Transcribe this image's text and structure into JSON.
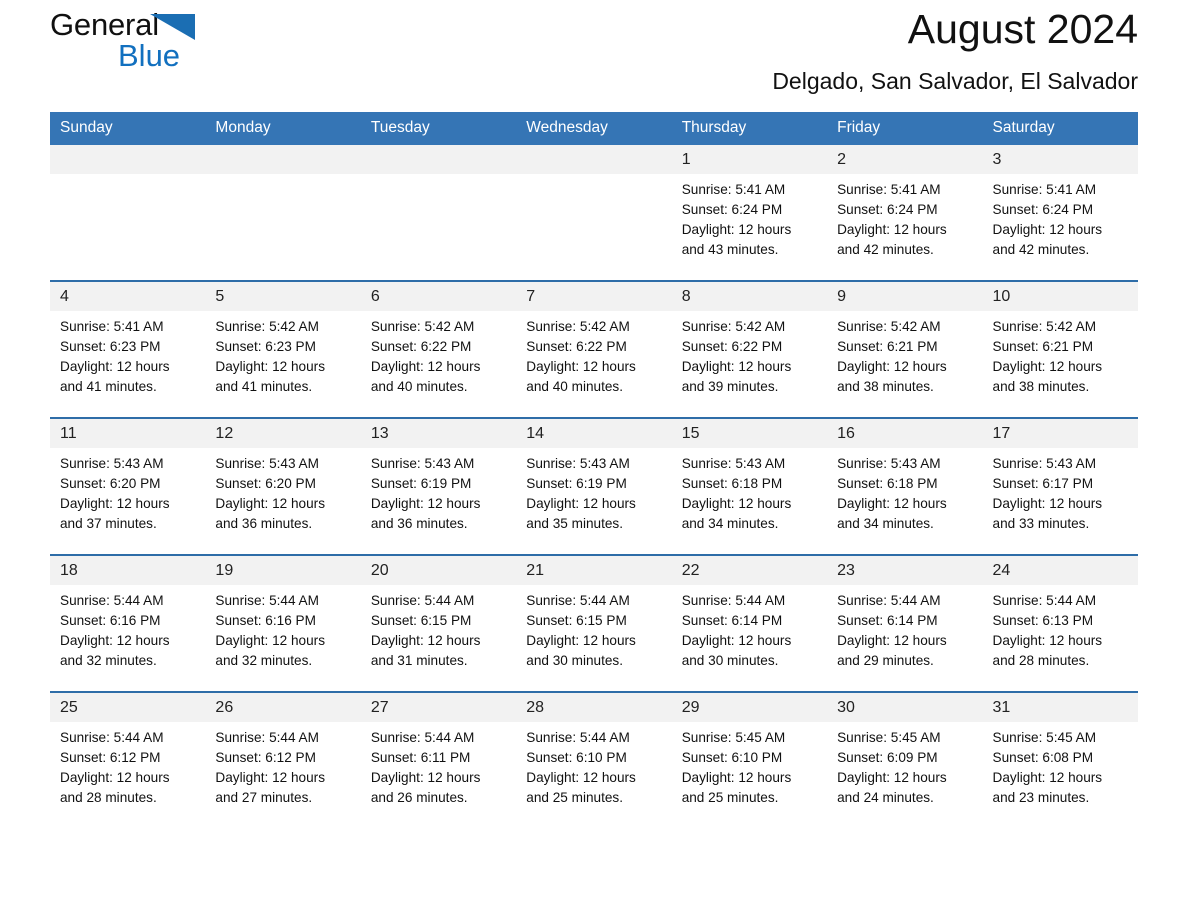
{
  "brand": {
    "name_part1": "General",
    "name_part2": "Blue",
    "logo_icon": "triangle-logo-icon",
    "accent_color": "#1B6EB3"
  },
  "header": {
    "title": "August 2024",
    "location": "Delgado, San Salvador, El Salvador"
  },
  "theme": {
    "header_blue": "#3575B5",
    "row_rule": "#2E6DA8",
    "daynum_band": "#F2F2F2"
  },
  "calendar": {
    "weekday_headers": [
      "Sunday",
      "Monday",
      "Tuesday",
      "Wednesday",
      "Thursday",
      "Friday",
      "Saturday"
    ],
    "weeks": [
      [
        {
          "day": "",
          "empty": true,
          "sunrise": "",
          "sunset": "",
          "daylight1": "",
          "daylight2": ""
        },
        {
          "day": "",
          "empty": true,
          "sunrise": "",
          "sunset": "",
          "daylight1": "",
          "daylight2": ""
        },
        {
          "day": "",
          "empty": true,
          "sunrise": "",
          "sunset": "",
          "daylight1": "",
          "daylight2": ""
        },
        {
          "day": "",
          "empty": true,
          "sunrise": "",
          "sunset": "",
          "daylight1": "",
          "daylight2": ""
        },
        {
          "day": "1",
          "sunrise": "Sunrise: 5:41 AM",
          "sunset": "Sunset: 6:24 PM",
          "daylight1": "Daylight: 12 hours",
          "daylight2": "and 43 minutes."
        },
        {
          "day": "2",
          "sunrise": "Sunrise: 5:41 AM",
          "sunset": "Sunset: 6:24 PM",
          "daylight1": "Daylight: 12 hours",
          "daylight2": "and 42 minutes."
        },
        {
          "day": "3",
          "sunrise": "Sunrise: 5:41 AM",
          "sunset": "Sunset: 6:24 PM",
          "daylight1": "Daylight: 12 hours",
          "daylight2": "and 42 minutes."
        }
      ],
      [
        {
          "day": "4",
          "sunrise": "Sunrise: 5:41 AM",
          "sunset": "Sunset: 6:23 PM",
          "daylight1": "Daylight: 12 hours",
          "daylight2": "and 41 minutes."
        },
        {
          "day": "5",
          "sunrise": "Sunrise: 5:42 AM",
          "sunset": "Sunset: 6:23 PM",
          "daylight1": "Daylight: 12 hours",
          "daylight2": "and 41 minutes."
        },
        {
          "day": "6",
          "sunrise": "Sunrise: 5:42 AM",
          "sunset": "Sunset: 6:22 PM",
          "daylight1": "Daylight: 12 hours",
          "daylight2": "and 40 minutes."
        },
        {
          "day": "7",
          "sunrise": "Sunrise: 5:42 AM",
          "sunset": "Sunset: 6:22 PM",
          "daylight1": "Daylight: 12 hours",
          "daylight2": "and 40 minutes."
        },
        {
          "day": "8",
          "sunrise": "Sunrise: 5:42 AM",
          "sunset": "Sunset: 6:22 PM",
          "daylight1": "Daylight: 12 hours",
          "daylight2": "and 39 minutes."
        },
        {
          "day": "9",
          "sunrise": "Sunrise: 5:42 AM",
          "sunset": "Sunset: 6:21 PM",
          "daylight1": "Daylight: 12 hours",
          "daylight2": "and 38 minutes."
        },
        {
          "day": "10",
          "sunrise": "Sunrise: 5:42 AM",
          "sunset": "Sunset: 6:21 PM",
          "daylight1": "Daylight: 12 hours",
          "daylight2": "and 38 minutes."
        }
      ],
      [
        {
          "day": "11",
          "sunrise": "Sunrise: 5:43 AM",
          "sunset": "Sunset: 6:20 PM",
          "daylight1": "Daylight: 12 hours",
          "daylight2": "and 37 minutes."
        },
        {
          "day": "12",
          "sunrise": "Sunrise: 5:43 AM",
          "sunset": "Sunset: 6:20 PM",
          "daylight1": "Daylight: 12 hours",
          "daylight2": "and 36 minutes."
        },
        {
          "day": "13",
          "sunrise": "Sunrise: 5:43 AM",
          "sunset": "Sunset: 6:19 PM",
          "daylight1": "Daylight: 12 hours",
          "daylight2": "and 36 minutes."
        },
        {
          "day": "14",
          "sunrise": "Sunrise: 5:43 AM",
          "sunset": "Sunset: 6:19 PM",
          "daylight1": "Daylight: 12 hours",
          "daylight2": "and 35 minutes."
        },
        {
          "day": "15",
          "sunrise": "Sunrise: 5:43 AM",
          "sunset": "Sunset: 6:18 PM",
          "daylight1": "Daylight: 12 hours",
          "daylight2": "and 34 minutes."
        },
        {
          "day": "16",
          "sunrise": "Sunrise: 5:43 AM",
          "sunset": "Sunset: 6:18 PM",
          "daylight1": "Daylight: 12 hours",
          "daylight2": "and 34 minutes."
        },
        {
          "day": "17",
          "sunrise": "Sunrise: 5:43 AM",
          "sunset": "Sunset: 6:17 PM",
          "daylight1": "Daylight: 12 hours",
          "daylight2": "and 33 minutes."
        }
      ],
      [
        {
          "day": "18",
          "sunrise": "Sunrise: 5:44 AM",
          "sunset": "Sunset: 6:16 PM",
          "daylight1": "Daylight: 12 hours",
          "daylight2": "and 32 minutes."
        },
        {
          "day": "19",
          "sunrise": "Sunrise: 5:44 AM",
          "sunset": "Sunset: 6:16 PM",
          "daylight1": "Daylight: 12 hours",
          "daylight2": "and 32 minutes."
        },
        {
          "day": "20",
          "sunrise": "Sunrise: 5:44 AM",
          "sunset": "Sunset: 6:15 PM",
          "daylight1": "Daylight: 12 hours",
          "daylight2": "and 31 minutes."
        },
        {
          "day": "21",
          "sunrise": "Sunrise: 5:44 AM",
          "sunset": "Sunset: 6:15 PM",
          "daylight1": "Daylight: 12 hours",
          "daylight2": "and 30 minutes."
        },
        {
          "day": "22",
          "sunrise": "Sunrise: 5:44 AM",
          "sunset": "Sunset: 6:14 PM",
          "daylight1": "Daylight: 12 hours",
          "daylight2": "and 30 minutes."
        },
        {
          "day": "23",
          "sunrise": "Sunrise: 5:44 AM",
          "sunset": "Sunset: 6:14 PM",
          "daylight1": "Daylight: 12 hours",
          "daylight2": "and 29 minutes."
        },
        {
          "day": "24",
          "sunrise": "Sunrise: 5:44 AM",
          "sunset": "Sunset: 6:13 PM",
          "daylight1": "Daylight: 12 hours",
          "daylight2": "and 28 minutes."
        }
      ],
      [
        {
          "day": "25",
          "sunrise": "Sunrise: 5:44 AM",
          "sunset": "Sunset: 6:12 PM",
          "daylight1": "Daylight: 12 hours",
          "daylight2": "and 28 minutes."
        },
        {
          "day": "26",
          "sunrise": "Sunrise: 5:44 AM",
          "sunset": "Sunset: 6:12 PM",
          "daylight1": "Daylight: 12 hours",
          "daylight2": "and 27 minutes."
        },
        {
          "day": "27",
          "sunrise": "Sunrise: 5:44 AM",
          "sunset": "Sunset: 6:11 PM",
          "daylight1": "Daylight: 12 hours",
          "daylight2": "and 26 minutes."
        },
        {
          "day": "28",
          "sunrise": "Sunrise: 5:44 AM",
          "sunset": "Sunset: 6:10 PM",
          "daylight1": "Daylight: 12 hours",
          "daylight2": "and 25 minutes."
        },
        {
          "day": "29",
          "sunrise": "Sunrise: 5:45 AM",
          "sunset": "Sunset: 6:10 PM",
          "daylight1": "Daylight: 12 hours",
          "daylight2": "and 25 minutes."
        },
        {
          "day": "30",
          "sunrise": "Sunrise: 5:45 AM",
          "sunset": "Sunset: 6:09 PM",
          "daylight1": "Daylight: 12 hours",
          "daylight2": "and 24 minutes."
        },
        {
          "day": "31",
          "sunrise": "Sunrise: 5:45 AM",
          "sunset": "Sunset: 6:08 PM",
          "daylight1": "Daylight: 12 hours",
          "daylight2": "and 23 minutes."
        }
      ]
    ]
  }
}
